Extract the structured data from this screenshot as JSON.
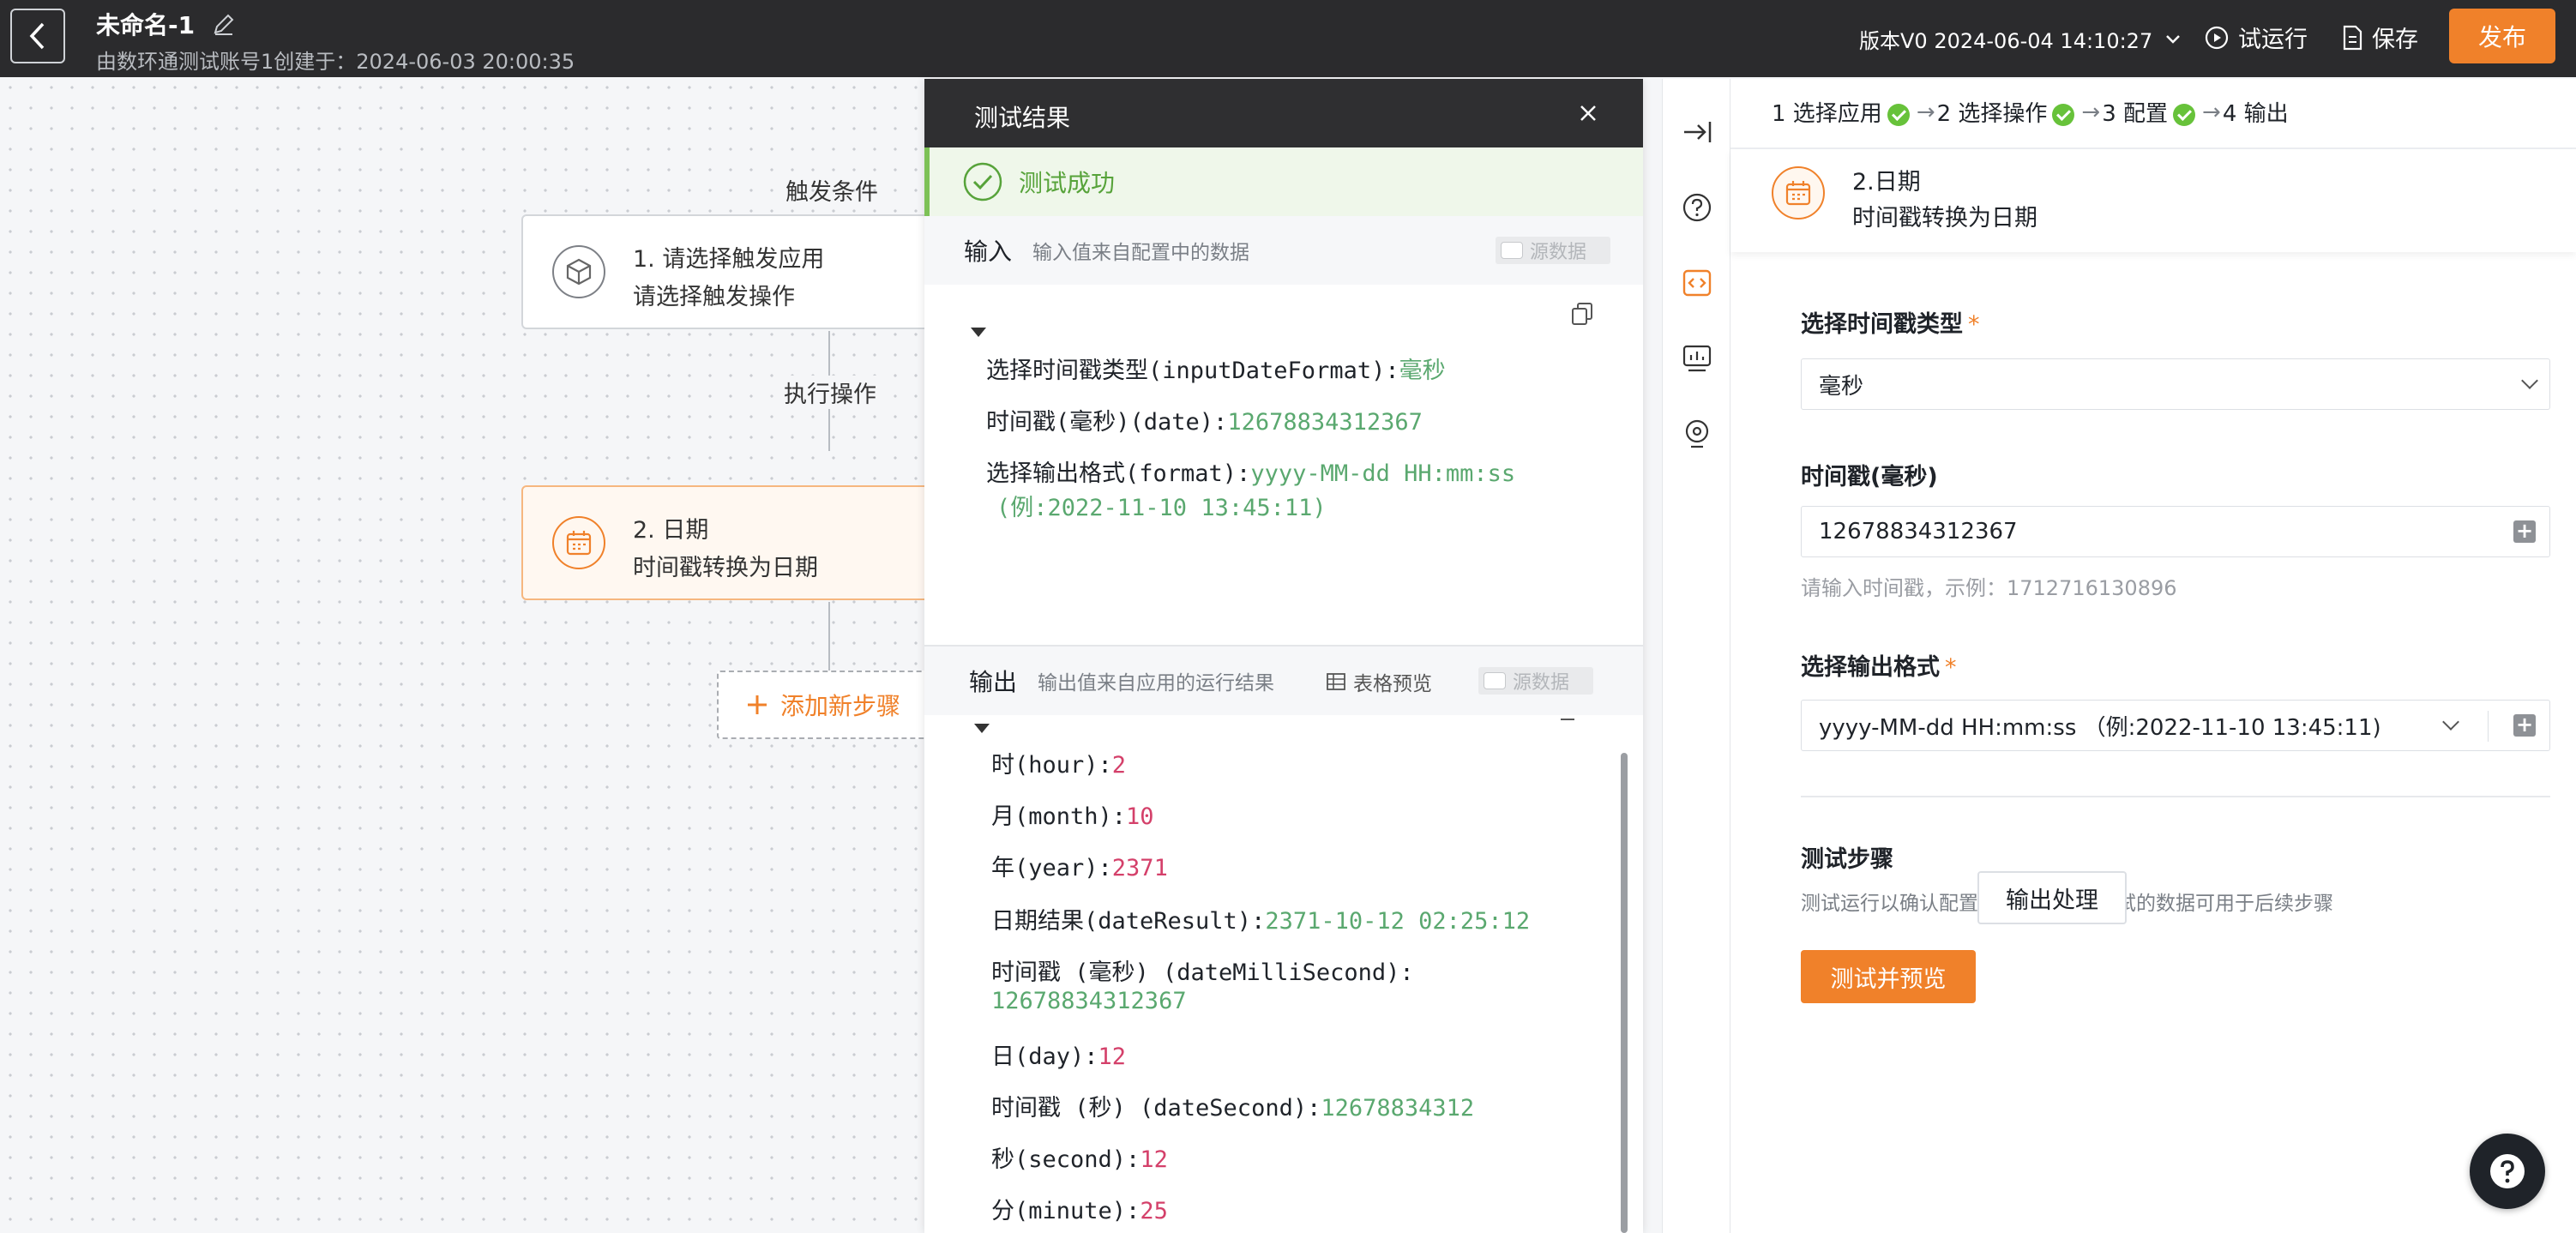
{
  "header": {
    "title": "未命名-1",
    "subtitle": "由数环通测试账号1创建于：2024-06-03 20:00:35",
    "version": "版本V0 2024-06-04 14:10:27",
    "test_run": "试运行",
    "save": "保存",
    "publish": "发布"
  },
  "canvas": {
    "trigger_label": "触发条件",
    "action_label": "执行操作",
    "node1": {
      "line1": "1. 请选择触发应用",
      "line2": "请选择触发操作"
    },
    "node2": {
      "line1": "2. 日期",
      "line2": "时间戳转换为日期"
    },
    "add_step": "添加新步骤"
  },
  "result_panel": {
    "title": "测试结果",
    "status": "测试成功",
    "input": {
      "title": "输入",
      "desc": "输入值来自配置中的数据",
      "raw_toggle": "源数据",
      "fields": [
        {
          "key": "选择时间戳类型(inputDateFormat):",
          "value": "毫秒",
          "kind": "s"
        },
        {
          "key": "时间戳(毫秒)(date):",
          "value": "12678834312367",
          "kind": "s"
        },
        {
          "key": "选择输出格式(format):",
          "value": "yyyy-MM-dd HH:mm:ss",
          "value2": "(例:2022-11-10 13:45:11)",
          "kind": "s"
        }
      ]
    },
    "output": {
      "title": "输出",
      "desc": "输出值来自应用的运行结果",
      "table_preview": "表格预览",
      "raw_toggle": "源数据",
      "fields": [
        {
          "key": "时(hour):",
          "value": "2",
          "kind": "n"
        },
        {
          "key": "月(month):",
          "value": "10",
          "kind": "n"
        },
        {
          "key": "年(year):",
          "value": "2371",
          "kind": "n"
        },
        {
          "key": "日期结果(dateResult):",
          "value": "2371-10-12 02:25:12",
          "kind": "s"
        },
        {
          "key": "时间戳 (毫秒) (dateMilliSecond):",
          "value": "12678834312367",
          "kind": "s"
        },
        {
          "key": "日(day):",
          "value": "12",
          "kind": "n"
        },
        {
          "key": "时间戳 (秒) (dateSecond):",
          "value": "12678834312",
          "kind": "s"
        },
        {
          "key": "秒(second):",
          "value": "12",
          "kind": "n"
        },
        {
          "key": "分(minute):",
          "value": "25",
          "kind": "n"
        }
      ]
    }
  },
  "config": {
    "steps": [
      {
        "label": "1 选择应用",
        "done": true
      },
      {
        "label": "2 选择操作",
        "done": true
      },
      {
        "label": "3 配置",
        "done": true
      },
      {
        "label": "4 输出",
        "done": false
      }
    ],
    "node_title": "2.日期",
    "node_subtitle": "时间戳转换为日期",
    "timestamp_type": {
      "label": "选择时间戳类型",
      "value": "毫秒"
    },
    "timestamp": {
      "label": "时间戳(毫秒)",
      "value": "12678834312367",
      "hint": "请输入时间戳，示例：1712716130896"
    },
    "output_format": {
      "label": "选择输出格式",
      "value": "yyyy-MM-dd HH:mm:ss （例:2022-11-10 13:45:11)"
    },
    "test_section": {
      "title": "测试步骤",
      "desc": "测试运行以确认配置是否正确，此测试的数据可用于后续步骤",
      "test_button": "测试并预览",
      "output_button": "输出处理"
    }
  },
  "colors": {
    "accent": "#f0812a",
    "success": "#67c23a",
    "header_bg": "#2b2b2d"
  }
}
